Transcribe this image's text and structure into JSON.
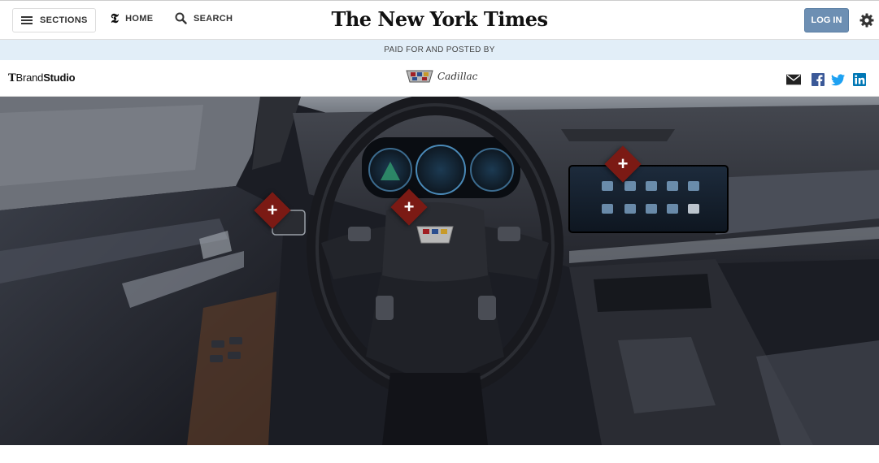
{
  "header": {
    "sections_label": "SECTIONS",
    "home_label": "HOME",
    "search_label": "SEARCH",
    "logo_text": "The New York Times",
    "login_label": "LOG IN"
  },
  "sponsor_band": {
    "text": "PAID FOR AND POSTED BY"
  },
  "brand_bar": {
    "brand_mark": "T",
    "brand_light": "Brand",
    "brand_bold": "Studio",
    "sponsor_name": "Cadillac",
    "social": [
      "mail-icon",
      "facebook-icon",
      "twitter-icon",
      "linkedin-icon"
    ]
  },
  "hero": {
    "hotspot_symbol": "+",
    "hotspot_color": "#7b1a14",
    "hotspots": [
      "door-controls",
      "steering-wheel",
      "infotainment-screen"
    ]
  },
  "colors": {
    "login_bg": "#6d8fb3",
    "sponsor_band_bg": "#e2eef8",
    "facebook": "#3b5998",
    "twitter": "#1da1f2",
    "linkedin": "#0077b5"
  }
}
